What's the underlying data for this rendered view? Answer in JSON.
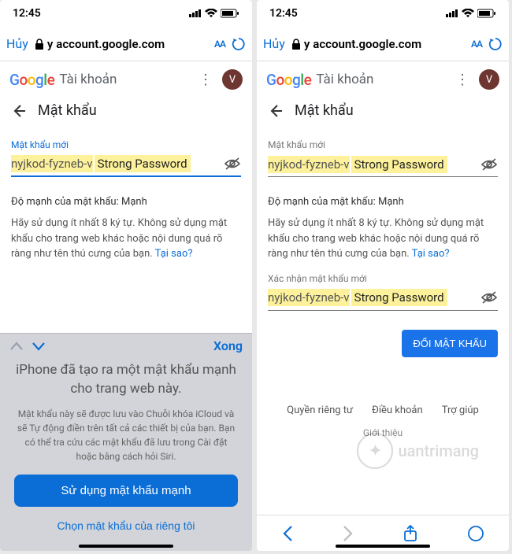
{
  "status": {
    "time": "12:45",
    "signal": "▮▯▮▮",
    "wifi": "⌃",
    "battery": "■"
  },
  "browser": {
    "cancel": "Hủy",
    "url_prefix": "y",
    "url": "account.google.com",
    "aa": "AA"
  },
  "header": {
    "google": {
      "g1": "G",
      "o1": "o",
      "o2": "o",
      "g2": "g",
      "l": "l",
      "e": "e"
    },
    "account_word": "Tài khoản",
    "avatar_letter": "V"
  },
  "page": {
    "title": "Mật khẩu",
    "new_pw_label": "Mật khẩu mới",
    "confirm_pw_label": "Xác nhận mật khẩu mới",
    "pw_value": "nyjkod-fyzneb-v",
    "pw_pill": "Strong Password",
    "strength_label": "Độ mạnh của mật khẩu:",
    "strength_value": "Mạnh",
    "hint": "Hãy sử dụng ít nhất 8 ký tự. Không sử dụng mật khẩu cho trang web khác hoặc nội dung quá rõ ràng như tên thú cưng của bạn.",
    "why": "Tại sao?",
    "change_btn": "ĐỔI MẬT KHẨU"
  },
  "keyboard_suggest": {
    "done": "Xong",
    "title": "iPhone đã tạo ra một mật khẩu mạnh cho trang web này.",
    "sub": "Mật khẩu này sẽ được lưu vào Chuỗi khóa iCloud và sẽ Tự động điền trên tất cả các thiết bị của bạn. Bạn có thể tra cứu các mật khẩu đã lưu trong Cài đặt hoặc bằng cách hỏi Siri.",
    "use": "Sử dụng mật khẩu mạnh",
    "own": "Chọn mật khẩu của riêng tôi"
  },
  "footer": {
    "privacy": "Quyền riêng tư",
    "terms": "Điều khoản",
    "help": "Trợ giúp",
    "about": "Giới thiệu"
  },
  "watermark": "uantrimang"
}
